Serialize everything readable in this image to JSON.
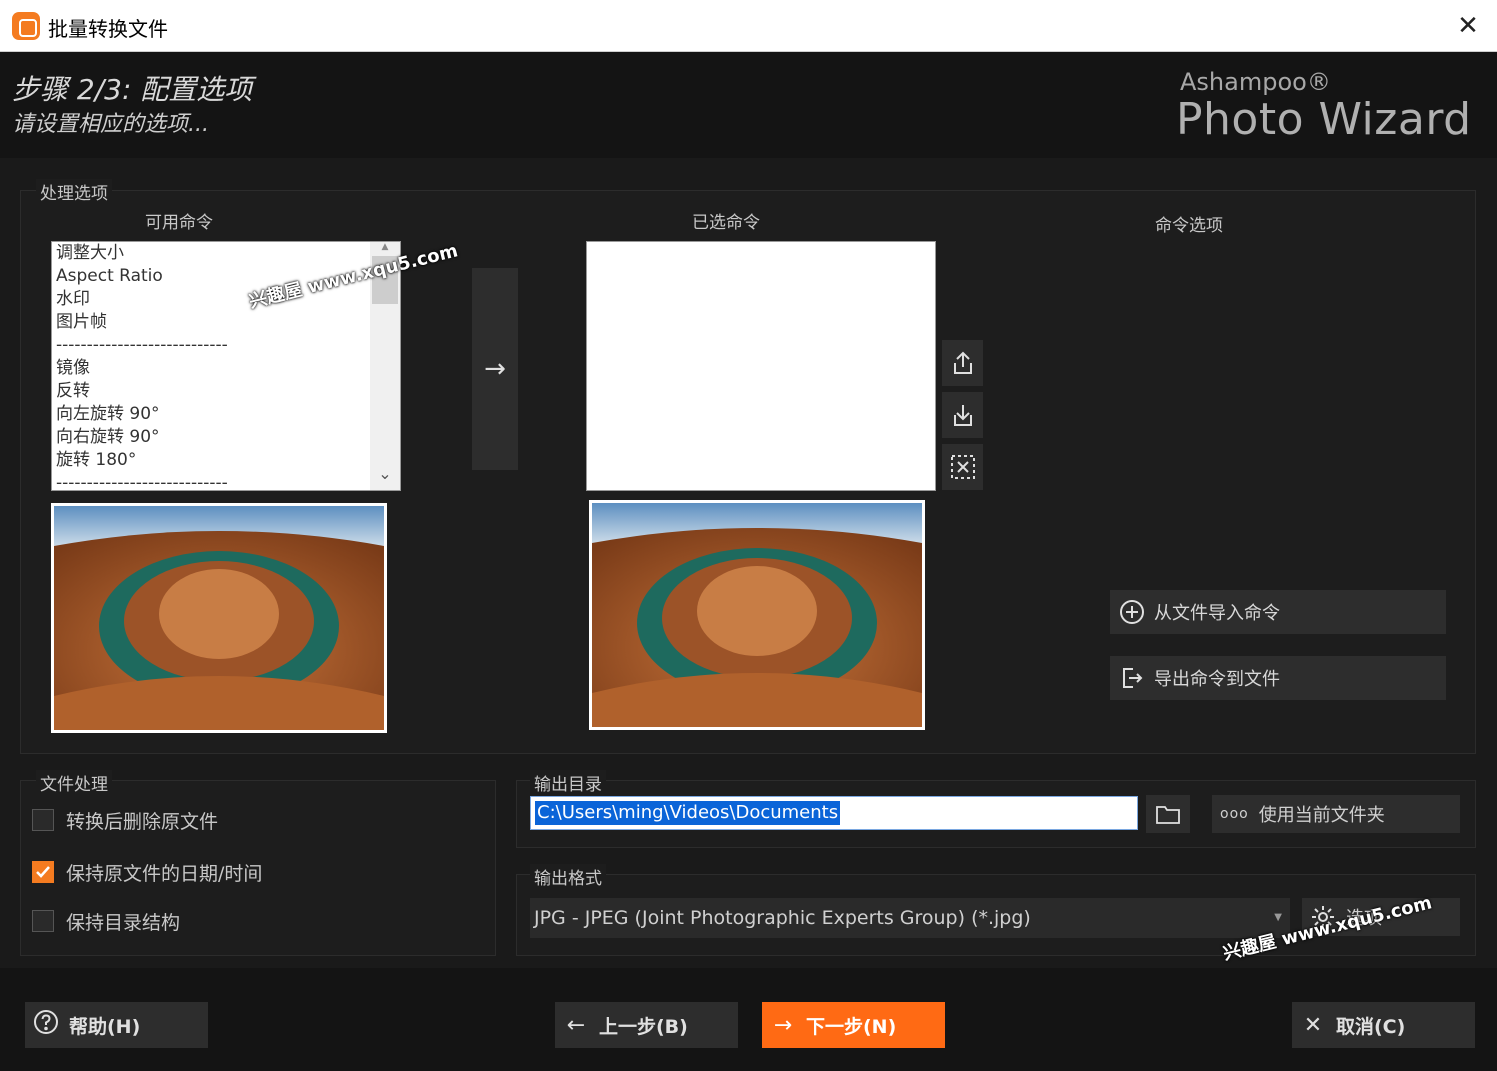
{
  "window": {
    "title": "批量转换文件",
    "close_glyph": "✕"
  },
  "header": {
    "step_title": "步骤 2/3: 配置选项",
    "step_subtitle": "请设置相应的选项...",
    "brand_small": "Ashampoo®",
    "brand_big": "Photo Wizard"
  },
  "processing": {
    "group_label": "处理选项",
    "available_label": "可用命令",
    "selected_label": "已选命令",
    "cmd_options_label": "命令选项",
    "available_commands": [
      "调整大小",
      "Aspect Ratio",
      "水印",
      "图片帧",
      "----------------------------",
      "镜像",
      "反转",
      "向左旋转 90°",
      "向右旋转 90°",
      "旋转 180°",
      "----------------------------"
    ],
    "add_arrow": "→",
    "import_cmd_label": "从文件导入命令",
    "export_cmd_label": "导出命令到文件"
  },
  "file_handling": {
    "group_label": "文件处理",
    "delete_original": {
      "label": "转换后删除原文件",
      "checked": false
    },
    "keep_date": {
      "label": "保持原文件的日期/时间",
      "checked": true
    },
    "keep_structure": {
      "label": "保持目录结构",
      "checked": false
    }
  },
  "output_dir": {
    "group_label": "输出目录",
    "path": "C:\\Users\\ming\\Videos\\Documents",
    "use_current_label": "使用当前文件夹"
  },
  "output_format": {
    "group_label": "输出格式",
    "selected": "JPG - JPEG (Joint Photographic Experts Group) (*.jpg)",
    "options_label": "选项"
  },
  "footer": {
    "help_label": "帮助(H)",
    "back_label": "上一步(B)",
    "next_label": "下一步(N)",
    "cancel_label": "取消(C)"
  },
  "watermarks": [
    "兴趣屋 www.xqu5.com",
    "兴趣屋 www.xqu5.com"
  ],
  "colors": {
    "accent": "#ff6a14",
    "background": "#1a1a1a",
    "selection": "#0a64d8"
  }
}
